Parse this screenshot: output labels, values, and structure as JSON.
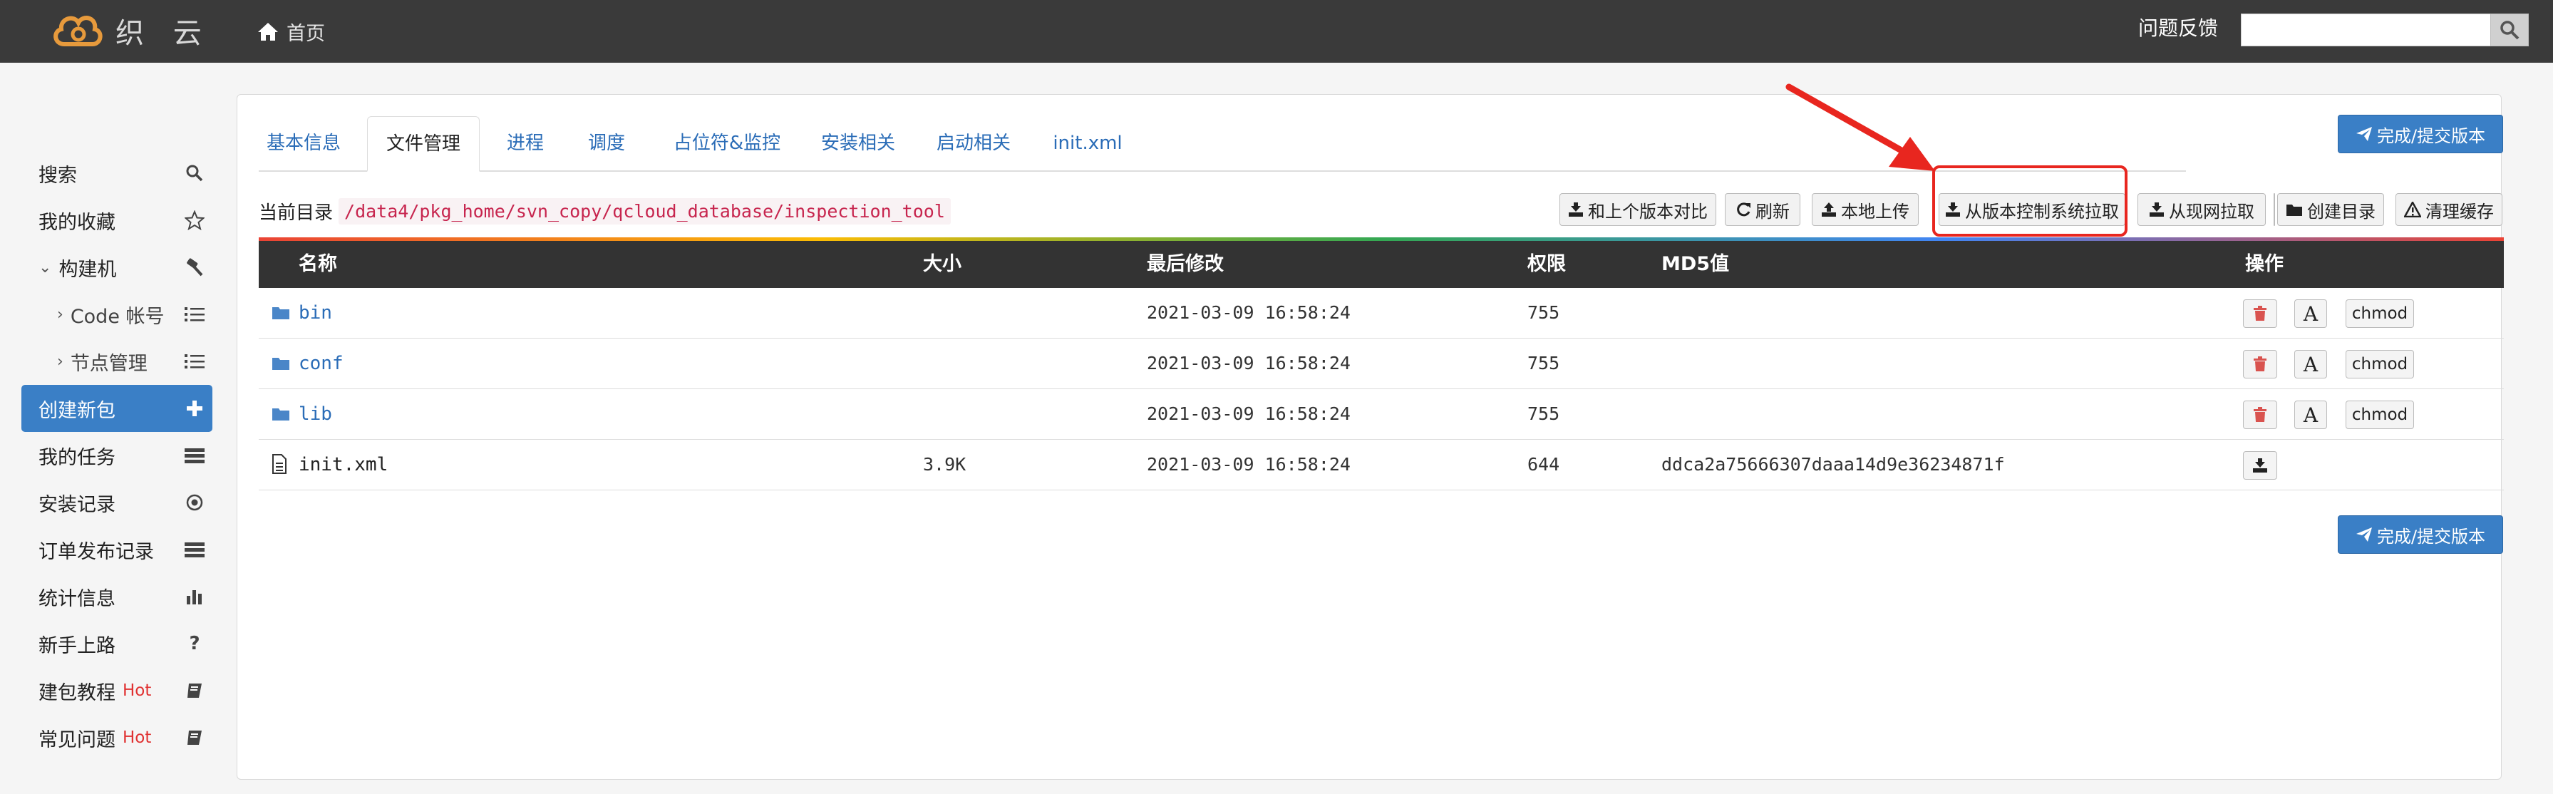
{
  "app": {
    "brand": "织 云",
    "home_label": "首页",
    "feedback_label": "问题反馈",
    "search_value": ""
  },
  "sidebar": {
    "items": [
      {
        "label": "搜索",
        "icon": "search-icon"
      },
      {
        "label": "我的收藏",
        "icon": "star-icon"
      },
      {
        "label": "构建机",
        "icon": "hammer-icon"
      },
      {
        "label": "Code 帐号",
        "icon": "list-icon"
      },
      {
        "label": "节点管理",
        "icon": "list-icon"
      },
      {
        "label": "创建新包",
        "icon": "plus-icon"
      },
      {
        "label": "我的任务",
        "icon": "tasks-icon"
      },
      {
        "label": "安装记录",
        "icon": "record-icon"
      },
      {
        "label": "订单发布记录",
        "icon": "tasks-icon"
      },
      {
        "label": "统计信息",
        "icon": "bar-chart-icon"
      },
      {
        "label": "新手上路",
        "icon": "question-icon"
      },
      {
        "label": "建包教程",
        "icon": "book-icon",
        "hot": "Hot"
      },
      {
        "label": "常见问题",
        "icon": "book-icon",
        "hot": "Hot"
      }
    ]
  },
  "tabs": [
    "基本信息",
    "文件管理",
    "进程",
    "调度",
    "占位符&监控",
    "安装相关",
    "启动相关",
    "init.xml"
  ],
  "submit_label": "完成/提交版本",
  "current_dir": {
    "label": "当前目录",
    "path": "/data4/pkg_home/svn_copy/qcloud_database/inspection_tool"
  },
  "toolbar": {
    "compare": "和上个版本对比",
    "refresh": "刷新",
    "upload": "本地上传",
    "pull_vcs": "从版本控制系统拉取",
    "pull_live": "从现网拉取",
    "mkdir": "创建目录",
    "clear_cache": "清理缓存"
  },
  "table": {
    "headers": [
      "名称",
      "大小",
      "最后修改",
      "权限",
      "MD5值",
      "操作"
    ],
    "rows": [
      {
        "name": "bin",
        "type": "folder",
        "size": "",
        "modified": "2021-03-09 16:58:24",
        "perm": "755",
        "md5": ""
      },
      {
        "name": "conf",
        "type": "folder",
        "size": "",
        "modified": "2021-03-09 16:58:24",
        "perm": "755",
        "md5": ""
      },
      {
        "name": "lib",
        "type": "folder",
        "size": "",
        "modified": "2021-03-09 16:58:24",
        "perm": "755",
        "md5": ""
      },
      {
        "name": "init.xml",
        "type": "file",
        "size": "3.9K",
        "modified": "2021-03-09 16:58:24",
        "perm": "644",
        "md5": "ddca2a75666307daaa14d9e36234871f"
      }
    ],
    "actions": {
      "chmod": "chmod",
      "font": "A"
    }
  },
  "colors": {
    "accent": "#3a7fc6",
    "topbar": "#3a3a3a",
    "highlight": "#e8261f",
    "link": "#2a6cb7"
  }
}
